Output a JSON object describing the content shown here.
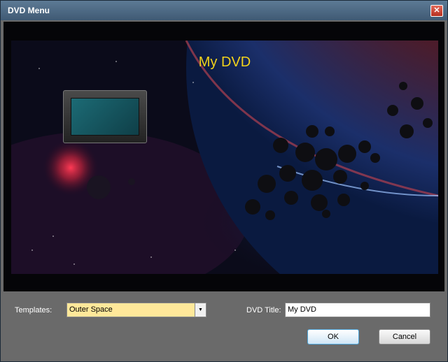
{
  "window": {
    "title": "DVD Menu",
    "close_glyph": "✕"
  },
  "preview": {
    "dvd_title": "My DVD",
    "background": "outer-space-scene"
  },
  "form": {
    "templates_label": "Templates:",
    "template_value": "Outer Space",
    "dvd_title_label": "DVD Title:",
    "dvd_title_value": "My DVD"
  },
  "buttons": {
    "ok": "OK",
    "cancel": "Cancel"
  },
  "colors": {
    "title_text": "#f2d21b",
    "select_bg": "#ffe89a",
    "panel_bg": "#6a6a6a"
  }
}
